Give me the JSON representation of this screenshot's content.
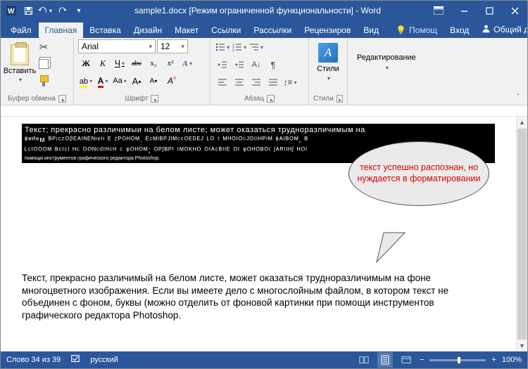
{
  "titlebar": {
    "title": "sample1.docx [Режим ограниченной функциональности] - Word"
  },
  "qat": {
    "save": "save-icon",
    "undo": "undo-icon",
    "redo": "redo-icon",
    "touch": "touch-icon"
  },
  "tabs": {
    "file": "Файл",
    "home": "Главная",
    "insert": "Вставка",
    "design": "Дизайн",
    "layout": "Макет",
    "refs": "Ссылки",
    "mail": "Рассылки",
    "review": "Рецензиров",
    "view": "Вид",
    "tell": "Помощ",
    "signin": "Вход",
    "share": "Общий доступ"
  },
  "ribbon": {
    "clipboard": {
      "paste": "Вставить",
      "label": "Буфер обмена"
    },
    "font": {
      "name": "Arial",
      "size": "12",
      "label": "Шрифт",
      "bold": "Ж",
      "italic": "К",
      "underline": "Ч",
      "strike": "abc",
      "sub": "x₂",
      "sup": "x²"
    },
    "paragraph": {
      "label": "Абзац"
    },
    "styles": {
      "btn": "Стили",
      "label": "Стили"
    },
    "editing": {
      "btn": "Редактирование"
    }
  },
  "document": {
    "corrupt1": "Текст; прекрасно различимыи на белом листе; может оказаться трудноразличимым на",
    "corrupt2": "ᶲᶱᴻᶱᴍ ᴮᴾᶦᶜᶻᴼᵝᴱᴬᴵᴺᴱᴺᶤᵉᴵᶤ ᴱ ᶻᴾᴼᴴᴼᴹ. ᴱᶜᴹᴵᴮᴾᴶᴵᴹᶜᶜᴼᴱᴰᴱᴶ ᴸᴼ ᵗ ᴹᴴᴼᴵᴼᶜᴶᴼᴵᴵᴴᴾᴵᴹ ᶲᴬᴵᴮᴼᴹ, ᴮ",
    "corrupt3": "ᴸᶜᴵᴼᴼᴼᴹ ᴮᶜᴵᶜᴵ ᴴᶜ ᴼᴼᴺᶜᵈᴵᴴᶜᴴ ᶜ ᵠᴼᴴᴼᴹ; ᴼᴾᶴᴮᴾᴵ ᵗᴹᴼᴷᴴᴼ ᴼᴵᴬᶜᴮᴵᴵᴱ ᴼᴵ ᵠᴼᴴᴼᴮᴼᴵ ᶴᴬᴿᴵᴵᴴᶴ ᴴᴼᴵ",
    "corrupt4": "помощи инструментов графического редактора Photoshop.",
    "callout": "текст успешно распознан, но нуждается в форматировании",
    "body": "Текст, прекрасно различимый на белом листе, может оказаться трудноразличимым на фоне многоцветного изображения. Если вы имеете дело с многослойным файлом, в котором текст не объединен с фоном, буквы (можно отделить от фоновой картинки при помощи инструментов графического редактора Photoshop."
  },
  "status": {
    "words": "Слово 34 из 39",
    "lang": "русский",
    "zoom": "100%"
  }
}
